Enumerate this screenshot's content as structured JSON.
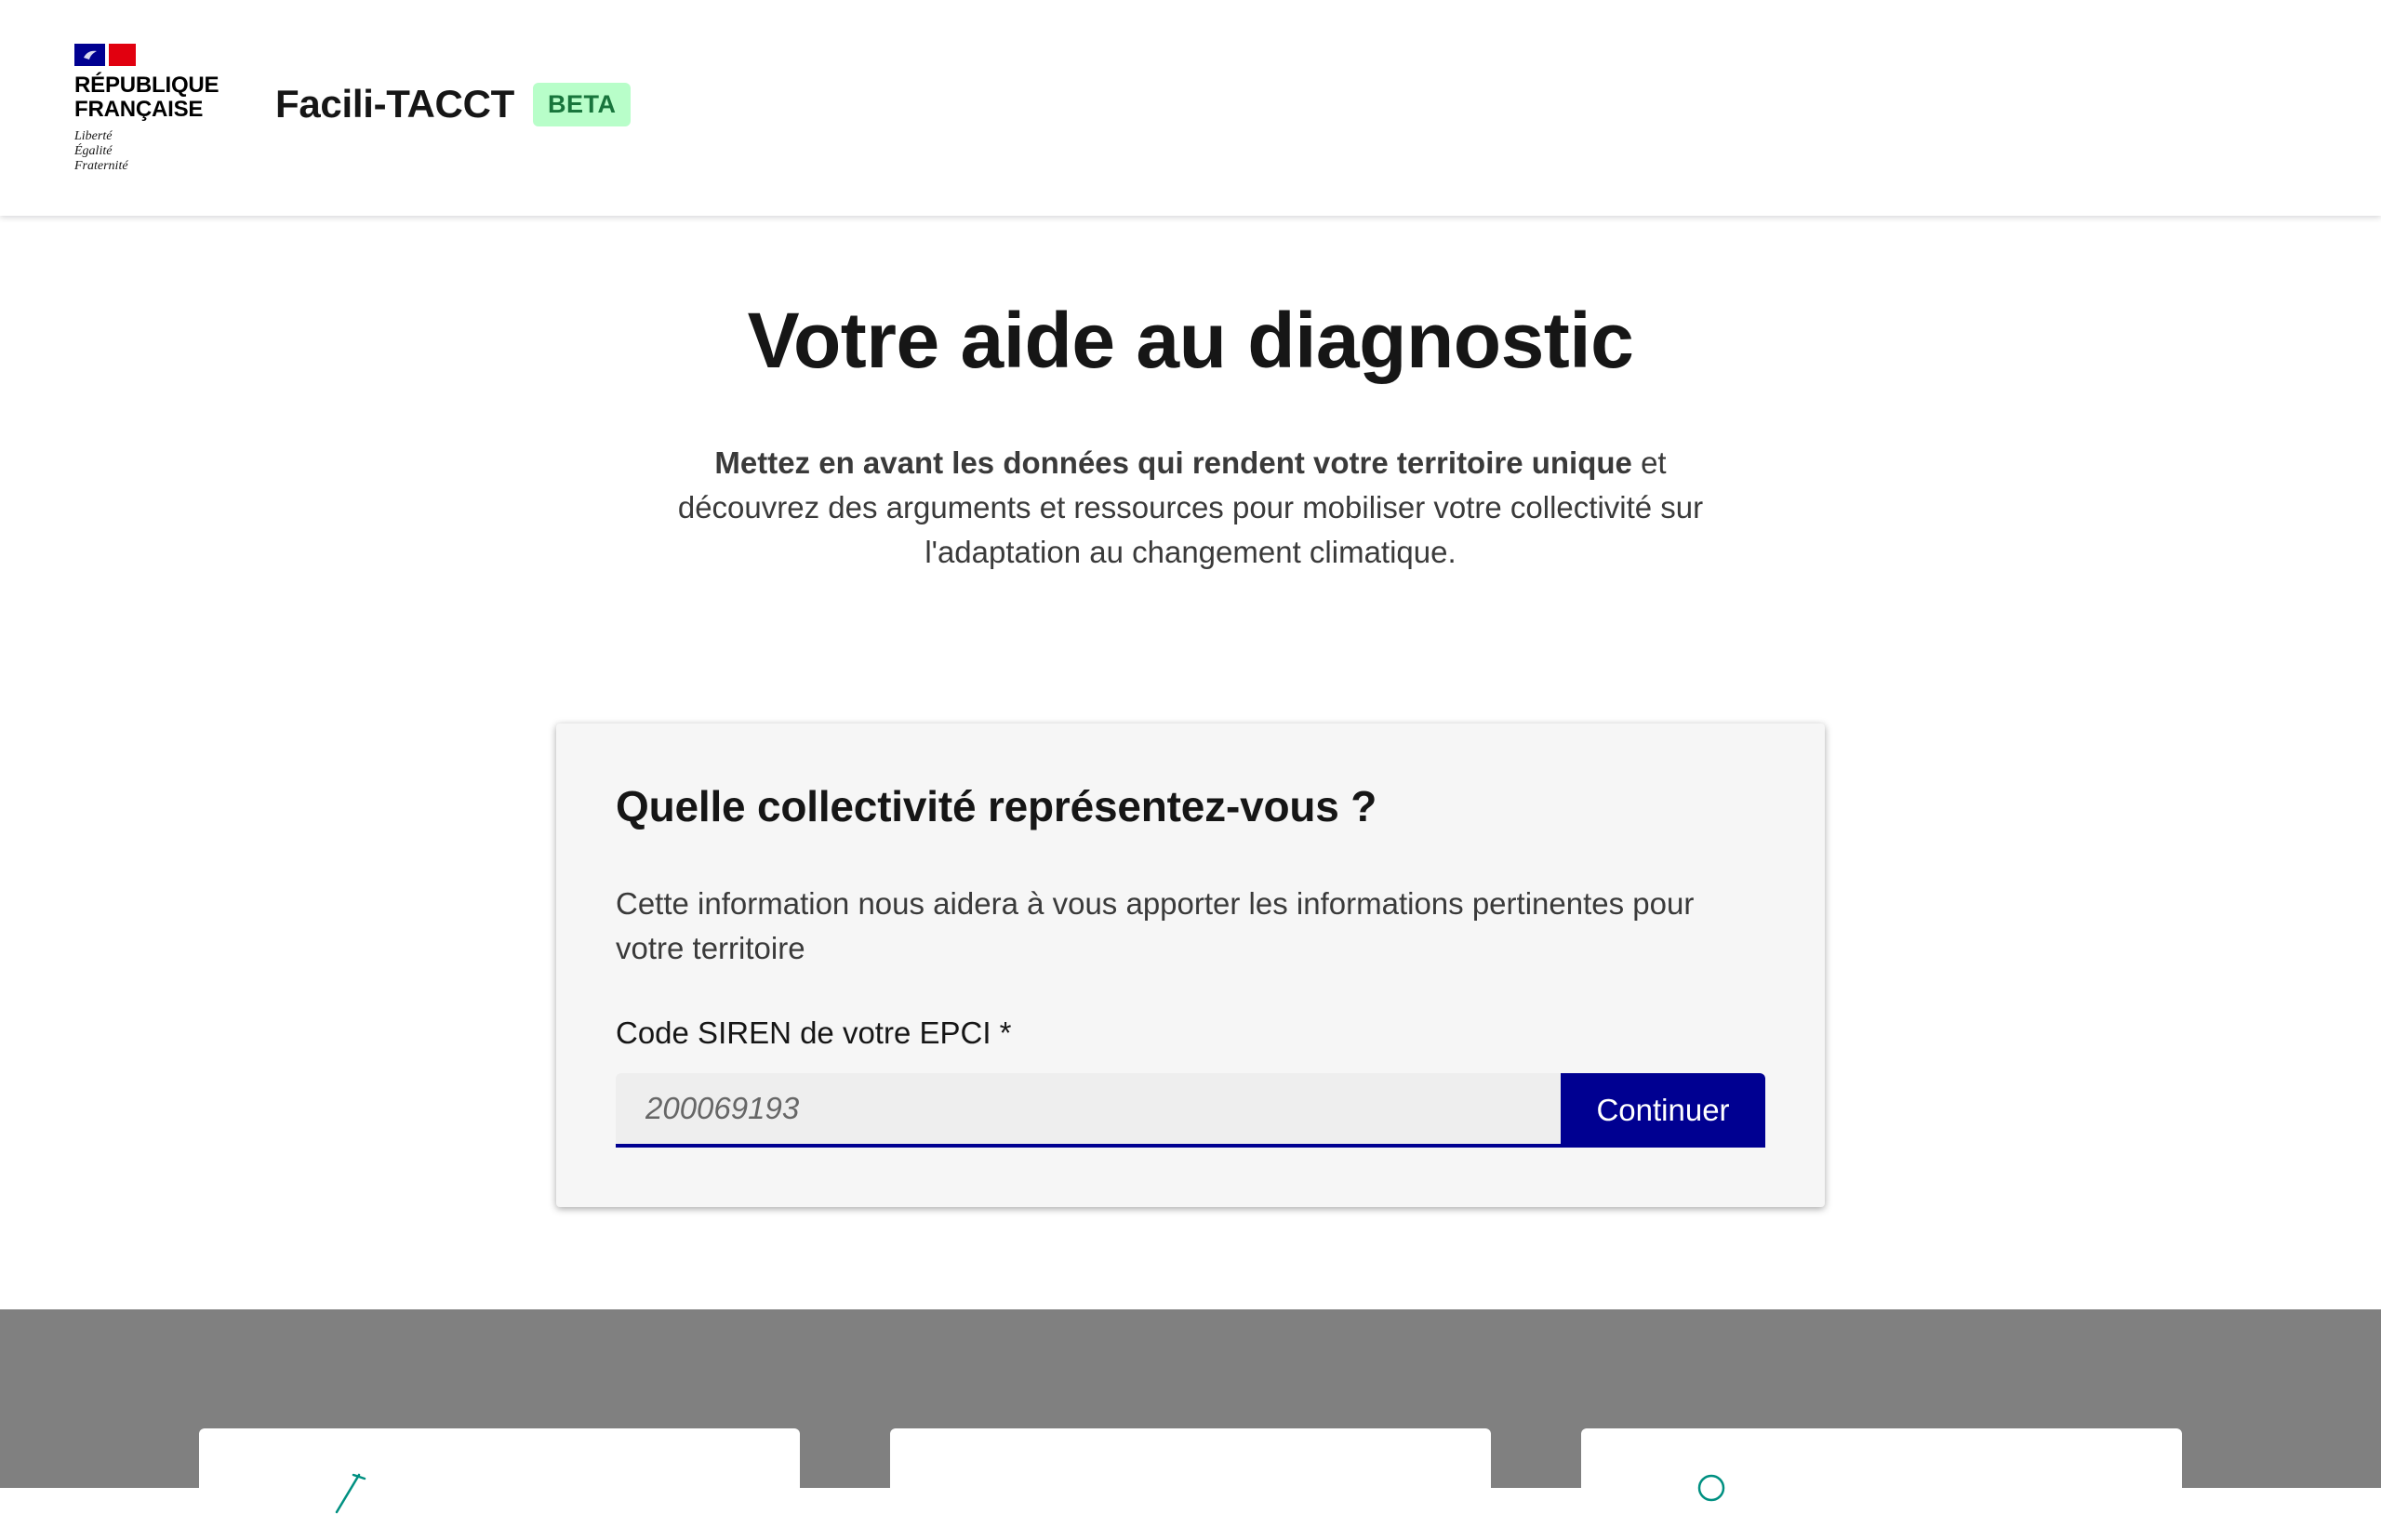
{
  "header": {
    "gov_logo": {
      "line1": "RÉPUBLIQUE",
      "line2": "FRANÇAISE",
      "motto": [
        "Liberté",
        "Égalité",
        "Fraternité"
      ],
      "flag_colors": [
        "#000091",
        "#ffffff",
        "#e1000f"
      ]
    },
    "site_name": "Facili-TACCT",
    "badge": "BETA"
  },
  "hero": {
    "title": "Votre aide au diagnostic",
    "desc_bold": "Mettez en avant les données qui rendent votre territoire unique",
    "desc_rest": " et découvrez des arguments et ressources pour mobiliser votre collectivité sur l'adaptation au changement climatique."
  },
  "form_card": {
    "title": "Quelle collectivité représentez-vous ?",
    "description": "Cette information nous aidera à vous apporter les informations pertinentes pour votre territoire",
    "field_label": "Code SIREN de votre EPCI *",
    "input_placeholder": "200069193",
    "input_value": "",
    "submit_label": "Continuer"
  },
  "bottom_cards": {
    "icons": [
      "pen-icon",
      "",
      "location-icon"
    ],
    "accent_color": "#009081"
  },
  "colors": {
    "primary": "#000091",
    "badge_bg": "#b8fec9",
    "badge_text": "#18753c",
    "bottom_bg": "#808080"
  }
}
